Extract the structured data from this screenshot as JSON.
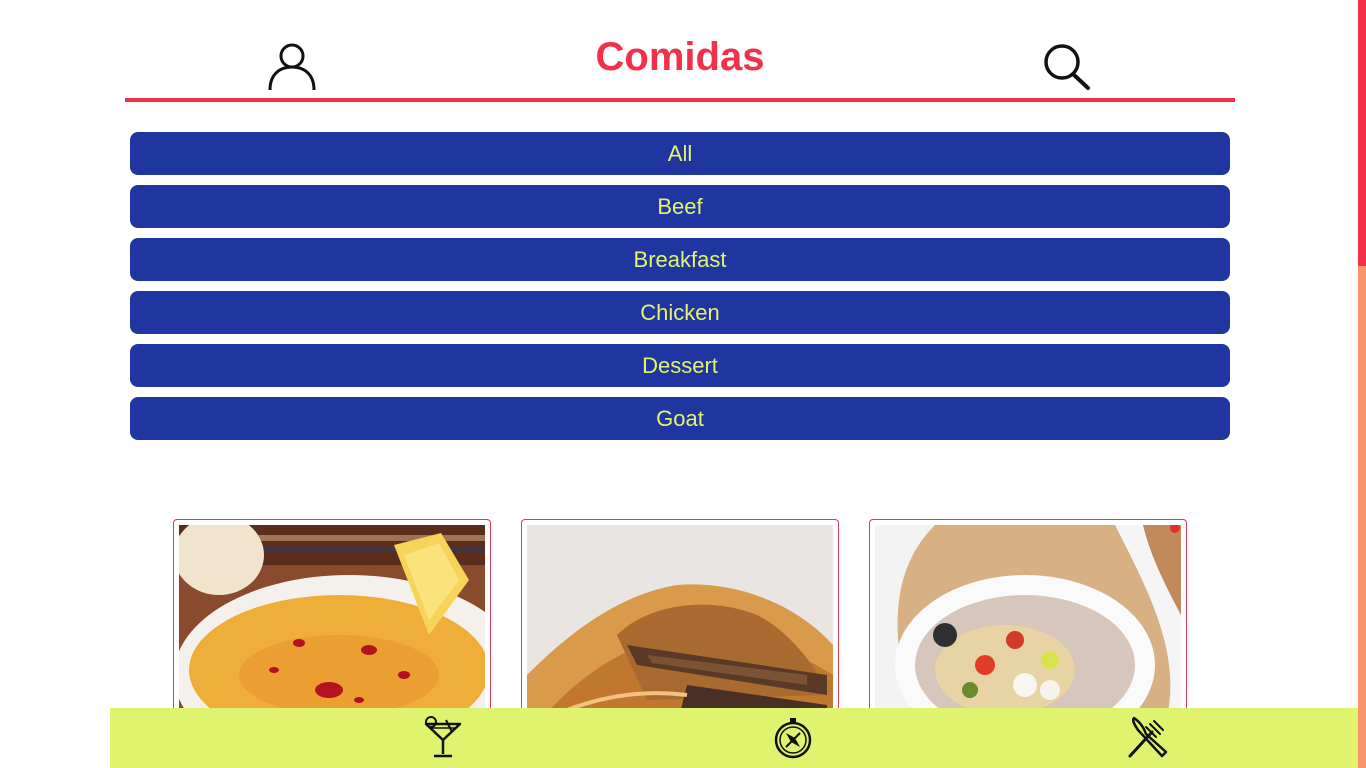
{
  "header": {
    "title": "Comidas",
    "profile_icon": "user-icon",
    "search_icon": "search-icon"
  },
  "categories": [
    {
      "label": "All"
    },
    {
      "label": "Beef"
    },
    {
      "label": "Breakfast"
    },
    {
      "label": "Chicken"
    },
    {
      "label": "Dessert"
    },
    {
      "label": "Goat"
    }
  ],
  "recipes": [
    {
      "image": "lentil-soup-photo"
    },
    {
      "image": "meat-pie-photo"
    },
    {
      "image": "stuffed-potato-photo"
    }
  ],
  "bottom_nav": [
    {
      "icon": "cocktail-icon"
    },
    {
      "icon": "compass-icon"
    },
    {
      "icon": "fork-knife-icon"
    }
  ],
  "colors": {
    "accent": "#f2304a",
    "category_button_bg": "#1f36a0",
    "category_button_text": "#e3f36f",
    "bottom_bar_bg": "#e0f36f",
    "card_border": "#e03a5a"
  }
}
